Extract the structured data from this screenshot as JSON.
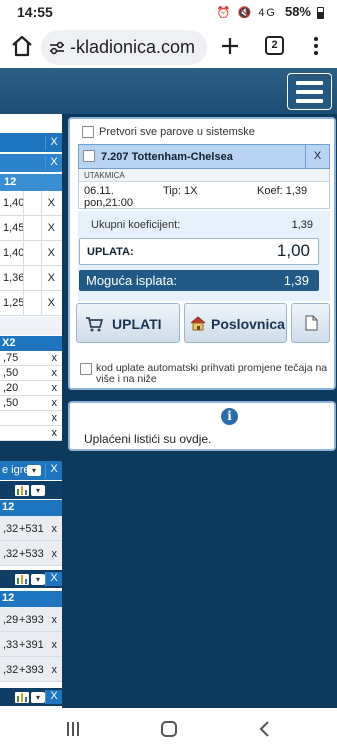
{
  "status_bar": {
    "time": "14:55",
    "icons": "⏰ 🔇 4G",
    "battery": "58%"
  },
  "browser": {
    "url": "-kladionica.com",
    "tab_count": "2"
  },
  "left_offer": {
    "header_x": "X",
    "sub_x": "X",
    "col_header": "12",
    "odds_rows": [
      "1,40",
      "1,45",
      "1,40",
      "1,36",
      "1,25"
    ],
    "row_x": "X",
    "block2_header": "X2",
    "block2_rows": [
      ",75",
      ",50",
      ",20",
      ",50",
      "",
      ""
    ],
    "block2_x": "x",
    "more_games_label": "e igre",
    "more_games_x": "X",
    "group1_header": "12",
    "group1_rows": [
      {
        "odd": ",32",
        "more": "+531",
        "x": "x"
      },
      {
        "odd": ",32",
        "more": "+533",
        "x": "x"
      }
    ],
    "group2_header": "12",
    "group2_rows": [
      {
        "odd": ",29",
        "more": "+393",
        "x": "x"
      },
      {
        "odd": ",33",
        "more": "+391",
        "x": "x"
      },
      {
        "odd": ",32",
        "more": "+393",
        "x": "x"
      }
    ],
    "tools_x": "X"
  },
  "ticket": {
    "system_checkbox_label": "Pretvori sve parove u sistemske",
    "pair": {
      "name": "7.207  Tottenham-Chelsea",
      "remove": "X",
      "section": "UTAKMICA",
      "date": "06.11.",
      "day_time": "pon,21:00",
      "tip": "Tip: 1X",
      "koef": "Koef: 1,39"
    },
    "total_odds_label": "Ukupni koeficijent:",
    "total_odds_value": "1,39",
    "stake_label": "UPLATA:",
    "stake_value": "1,00",
    "payout_label": "Moguća isplata:",
    "payout_value": "1,39",
    "btn_pay": "UPLATI",
    "btn_shop": "Poslovnica",
    "auto_accept_label": "kod uplate automatski prihvati promjene tečaja na više i na niže"
  },
  "info": {
    "text": "Uplaćeni listići su ovdje."
  },
  "colors": {
    "page_bg": "#0d3a5c",
    "header_blue": "#1f75bd",
    "pair_highlight": "#b8d4f1",
    "payout_bg": "#205a85"
  },
  "icons": [
    "home-icon",
    "site-settings-icon",
    "plus-icon",
    "menu-dots-icon",
    "hamburger-icon",
    "cart-icon",
    "house-icon",
    "document-icon",
    "info-icon",
    "stats-icon",
    "dropdown-icon"
  ]
}
